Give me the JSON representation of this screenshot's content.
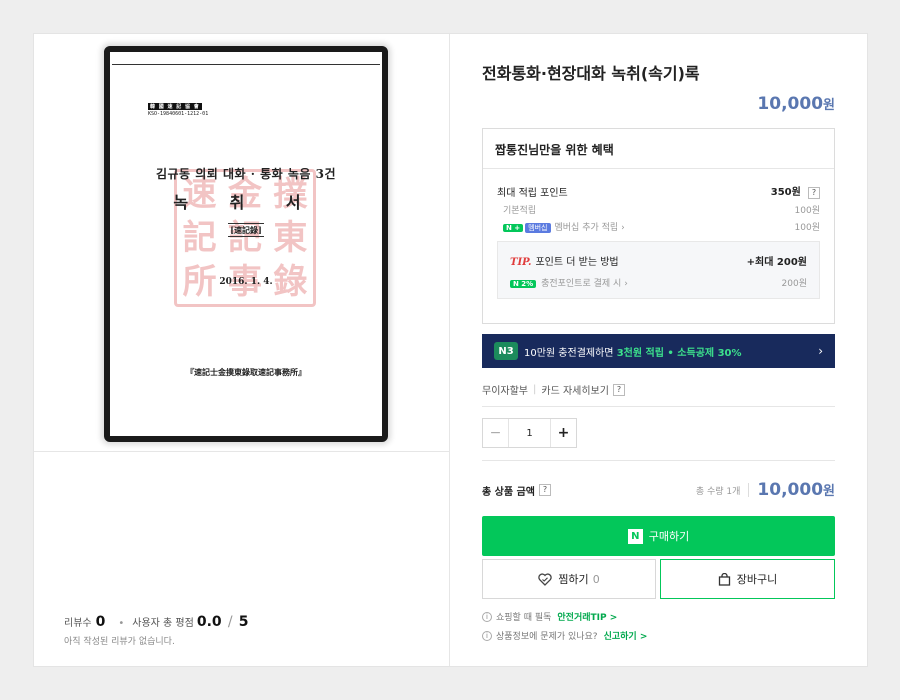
{
  "document_image": {
    "code_label": "韓 國 速 記 協 會",
    "code_number": "KSO-19840601-1212-01",
    "title": "김규동 의뢰 대화 · 통화 녹음 3건",
    "big_title": "녹 취 서",
    "sub_title": "[速記錄]",
    "date": "2016. 1. 4.",
    "footer": "『速記士金撲東錄取速記事務所』"
  },
  "reviews": {
    "count_label": "리뷰수",
    "count": "0",
    "score_label": "사용자 총 평점",
    "score": "0.0",
    "score_max": "5",
    "empty_note": "아직 작성된 리뷰가 없습니다."
  },
  "product": {
    "title": "전화통화·현장대화 녹취(속기)록",
    "price": "10,000",
    "currency": "원"
  },
  "benefit": {
    "heading": "짭통진님만을 위한 혜택",
    "max_points_label": "최대 적립 포인트",
    "max_points_value": "350원",
    "basic_label": "기본적립",
    "basic_value": "100원",
    "membership_pill_n": "N +",
    "membership_pill_label": "멤버십",
    "membership_label": "멤버십 추가 적립",
    "membership_value": "100원",
    "tip_label": "TIP.",
    "tip_text": "포인트 더 받는 방법",
    "tip_value": "+최대 200원",
    "charge_pill": "N 2%",
    "charge_label": "충전포인트로 결제 시",
    "charge_value": "200원"
  },
  "banner": {
    "badge": "N3",
    "text_prefix": "10만원 충전결제하면",
    "text_highlight": "3천원 적립 • 소득공제 30%"
  },
  "installment": {
    "label": "무이자할부",
    "card_info": "카드 자세히보기"
  },
  "quantity": {
    "minus": "−",
    "value": "1",
    "plus": "+"
  },
  "total": {
    "label": "총 상품 금액",
    "count_text": "총 수량 1개",
    "amount": "10,000",
    "currency": "원"
  },
  "buttons": {
    "buy_n": "N",
    "buy": "구매하기",
    "wish": "찜하기",
    "wish_count": "0",
    "cart": "장바구니"
  },
  "notes": {
    "safe_text": "쇼핑할 때 필독",
    "safe_link": "안전거래TIP >",
    "report_text": "상품정보에 문제가 있나요?",
    "report_link": "신고하기 >"
  },
  "colors": {
    "naver_green": "#03c75a",
    "price_blue": "#5a77b0",
    "banner_navy": "#182a5c",
    "tip_red": "#e03c3c"
  }
}
